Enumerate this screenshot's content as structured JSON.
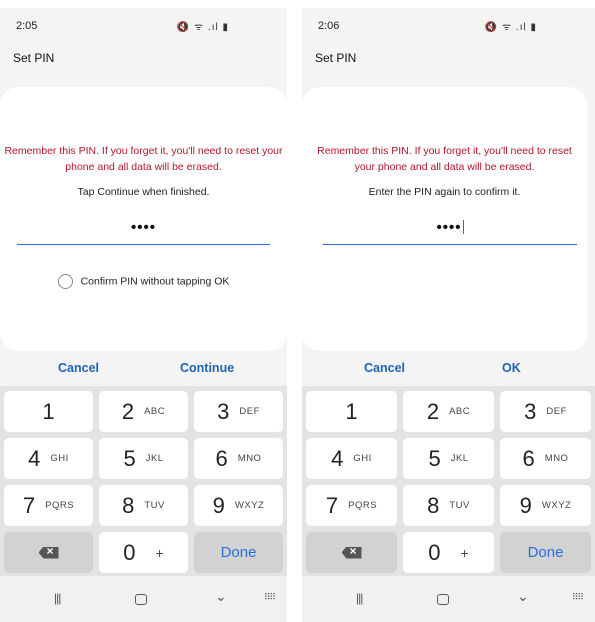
{
  "screens": [
    {
      "status": {
        "time": "2:05",
        "icons": "🔇 ᯤ .ıl ▮"
      },
      "title": "Set PIN",
      "warning": "Remember this PIN. If you forget it, you'll need to reset your phone and all data will be erased.",
      "hint": "Tap Continue when finished.",
      "pin_value": "••••",
      "confirm_option": "Confirm PIN without tapping OK",
      "cancel_label": "Cancel",
      "primary_label": "Continue"
    },
    {
      "status": {
        "time": "2:06",
        "icons": "🔇 ᯤ .ıl ▮"
      },
      "title": "Set PIN",
      "warning": "Remember this PIN. If you forget it, you'll need to reset your phone and all data will be erased.",
      "hint": "Enter the PIN again to confirm it.",
      "pin_value": "••••",
      "cancel_label": "Cancel",
      "primary_label": "OK"
    }
  ],
  "keypad": {
    "keys": [
      {
        "num": "1",
        "letters": ""
      },
      {
        "num": "2",
        "letters": "ABC"
      },
      {
        "num": "3",
        "letters": "DEF"
      },
      {
        "num": "4",
        "letters": "GHI"
      },
      {
        "num": "5",
        "letters": "JKL"
      },
      {
        "num": "6",
        "letters": "MNO"
      },
      {
        "num": "7",
        "letters": "PQRS"
      },
      {
        "num": "8",
        "letters": "TUV"
      },
      {
        "num": "9",
        "letters": "WXYZ"
      }
    ],
    "zero": "0",
    "plus": "+",
    "done_label": "Done",
    "backspace_icon": "backspace-icon"
  },
  "navbar": {
    "recent_icon": "recent-apps-icon",
    "home_icon": "home-icon",
    "back_icon": "back-chevron-icon",
    "keyboard_icon": "keyboard-icon",
    "recent_glyph": "|||",
    "back_glyph": "⌄",
    "keyboard_glyph": "⠿⠿"
  },
  "colors": {
    "warning": "#b5152b",
    "accent": "#2b6fd6",
    "action": "#1f63b6",
    "keypad_bg": "#e3e3e3"
  }
}
